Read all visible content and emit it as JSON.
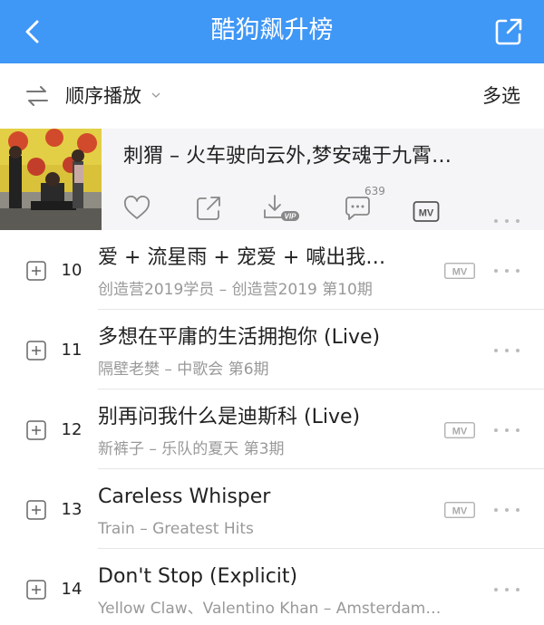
{
  "header": {
    "title": "酷狗飙升榜",
    "back_icon": "chevron-left-icon",
    "share_icon": "share-icon",
    "bg_color": "#3f97f6"
  },
  "toolbar": {
    "play_mode_label": "顺序播放",
    "play_mode_icon": "sequence-play-icon",
    "multi_select_label": "多选"
  },
  "current": {
    "song": "刺猬 – 火车驶向云外,梦安魂于九霄…",
    "comment_count": "639",
    "actions": [
      "heart-icon",
      "share-icon",
      "download-vip-icon",
      "comment-icon",
      "mv-icon",
      "more-icon"
    ]
  },
  "songs": [
    {
      "rank": "10",
      "title": "爱 + 流星雨 + 宠爱 + 喊出我…",
      "subtitle": "创造营2019学员 – 创造营2019 第10期",
      "has_mv": true
    },
    {
      "rank": "11",
      "title": "多想在平庸的生活拥抱你 (Live)",
      "subtitle": "隔壁老樊 – 中歌会 第6期",
      "has_mv": false
    },
    {
      "rank": "12",
      "title": "别再问我什么是迪斯科 (Live)",
      "subtitle": "新裤子 – 乐队的夏天 第3期",
      "has_mv": true
    },
    {
      "rank": "13",
      "title": "Careless Whisper",
      "subtitle": "Train – Greatest Hits",
      "has_mv": true
    },
    {
      "rank": "14",
      "title": "Don't Stop (Explicit)",
      "subtitle": "Yellow Claw、Valentino Khan – Amsterdam…",
      "has_mv": false
    }
  ]
}
